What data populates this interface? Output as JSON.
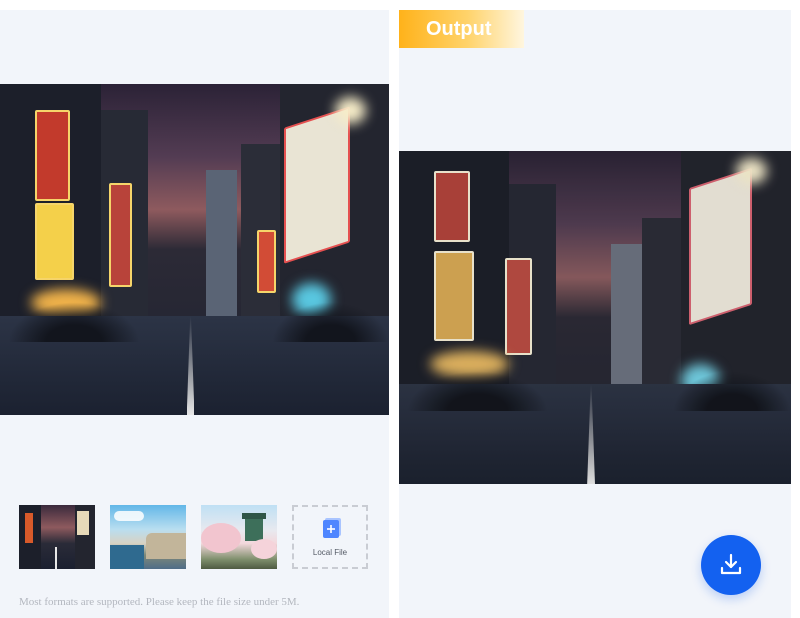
{
  "input_panel": {
    "image_alt": "Night city street with neon signs",
    "thumbnails": [
      {
        "name": "night-street"
      },
      {
        "name": "coastal-city"
      },
      {
        "name": "castle-cherry-blossom"
      }
    ],
    "local_file_label": "Local File",
    "hint": "Most formats are supported. Please keep the file size under 5M."
  },
  "output_panel": {
    "badge_label": "Output"
  },
  "colors": {
    "panel_bg": "#f2f5fa",
    "accent_blue": "#1361f0",
    "badge_orange": "#ffb21a"
  },
  "icons": {
    "upload": "file-plus-icon",
    "download": "download-icon"
  }
}
